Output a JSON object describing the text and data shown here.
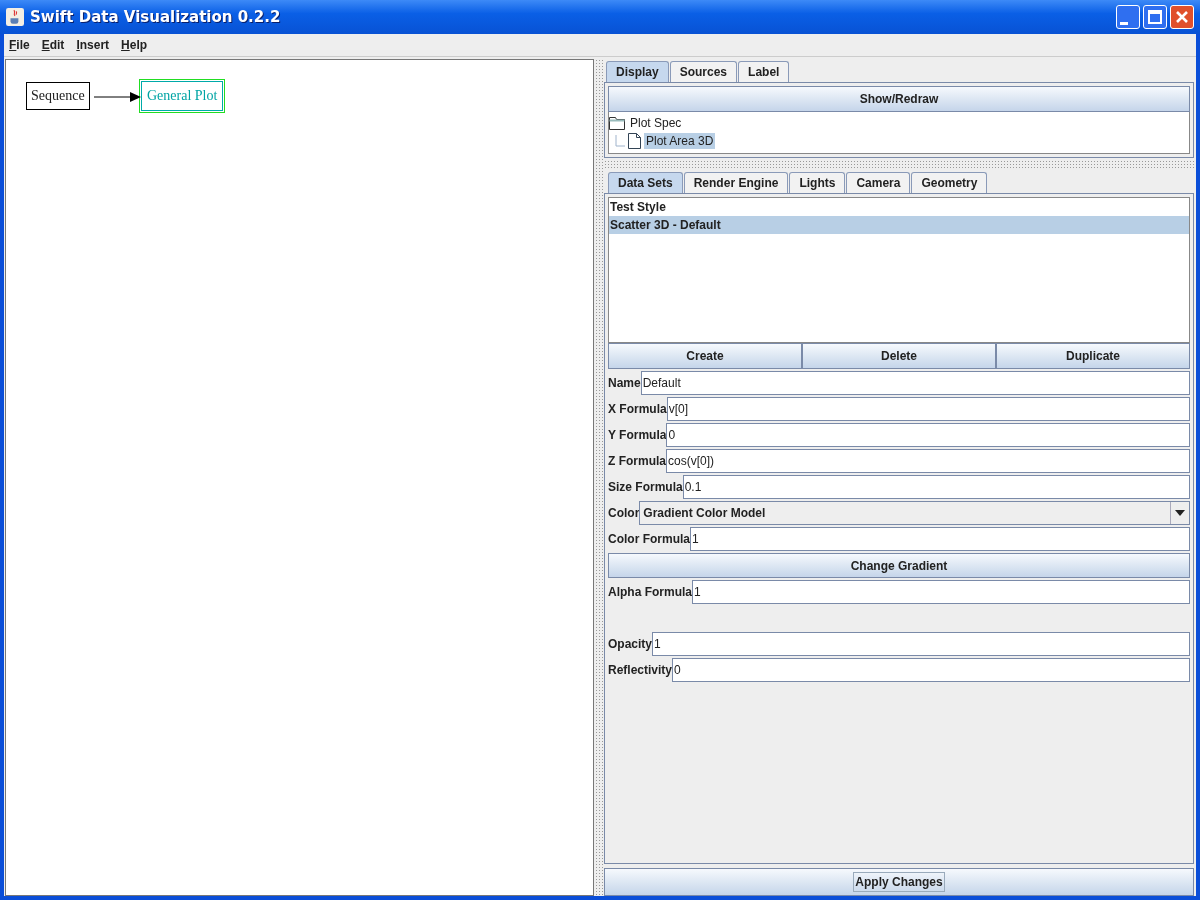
{
  "window": {
    "title": "Swift Data Visualization 0.2.2"
  },
  "menu": [
    {
      "label": "File"
    },
    {
      "label": "Edit"
    },
    {
      "label": "Insert"
    },
    {
      "label": "Help"
    }
  ],
  "diagram": {
    "nodes": [
      {
        "label": "Sequence",
        "selected": false
      },
      {
        "label": "General Plot",
        "selected": true
      }
    ]
  },
  "top_tabs": [
    {
      "label": "Display",
      "selected": true
    },
    {
      "label": "Sources",
      "selected": false
    },
    {
      "label": "Label",
      "selected": false
    }
  ],
  "show_redraw": "Show/Redraw",
  "tree": [
    {
      "label": "Plot Spec",
      "selected": false,
      "children": [
        {
          "label": "Plot Area 3D",
          "selected": true
        }
      ]
    }
  ],
  "sub_tabs": [
    {
      "label": "Data Sets",
      "selected": true
    },
    {
      "label": "Render Engine",
      "selected": false
    },
    {
      "label": "Lights",
      "selected": false
    },
    {
      "label": "Camera",
      "selected": false
    },
    {
      "label": "Geometry",
      "selected": false
    }
  ],
  "data_sets": [
    {
      "label": "Test Style",
      "selected": false
    },
    {
      "label": "Scatter 3D - Default",
      "selected": true
    }
  ],
  "list_buttons": [
    "Create",
    "Delete",
    "Duplicate"
  ],
  "form": [
    {
      "kind": "field",
      "label": "Name",
      "value": "Default"
    },
    {
      "kind": "field",
      "label": "X Formula",
      "value": "v[0]"
    },
    {
      "kind": "field",
      "label": "Y Formula",
      "value": "0"
    },
    {
      "kind": "field",
      "label": "Z Formula",
      "value": "cos(v[0])"
    },
    {
      "kind": "field",
      "label": "Size Formula",
      "value": "0.1"
    },
    {
      "kind": "select",
      "label": "Color",
      "value": "Gradient Color Model"
    },
    {
      "kind": "field",
      "label": "Color Formula",
      "value": "1"
    },
    {
      "kind": "button",
      "label": "Change Gradient"
    },
    {
      "kind": "field",
      "label": "Alpha Formula",
      "value": "1"
    },
    {
      "kind": "spacer"
    },
    {
      "kind": "field",
      "label": "Opacity",
      "value": "1"
    },
    {
      "kind": "field",
      "label": "Reflectivity",
      "value": "0"
    }
  ],
  "apply_button": "Apply Changes"
}
